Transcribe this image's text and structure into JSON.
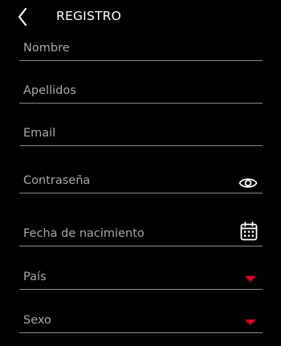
{
  "header": {
    "title": "REGISTRO",
    "back_icon": "chevron-left-icon"
  },
  "form": {
    "fields": [
      {
        "id": "nombre",
        "label": "Nombre",
        "type": "text",
        "value": ""
      },
      {
        "id": "apellidos",
        "label": "Apellidos",
        "type": "text",
        "value": ""
      },
      {
        "id": "email",
        "label": "Email",
        "type": "email",
        "value": ""
      },
      {
        "id": "contrasena",
        "label": "Contraseña",
        "type": "password",
        "value": "",
        "icon": "eye-icon"
      },
      {
        "id": "fecha",
        "label": "Fecha de nacimiento",
        "type": "date",
        "value": "",
        "icon": "calendar-icon"
      },
      {
        "id": "pais",
        "label": "País",
        "type": "select",
        "value": "",
        "icon": "caret-down-icon"
      },
      {
        "id": "sexo",
        "label": "Sexo",
        "type": "select",
        "value": "",
        "icon": "caret-down-icon"
      }
    ]
  },
  "colors": {
    "background": "#000000",
    "text": "#ffffff",
    "label": "#a8a8a8",
    "underline": "#8a8a8a",
    "accent": "#e3001b"
  }
}
